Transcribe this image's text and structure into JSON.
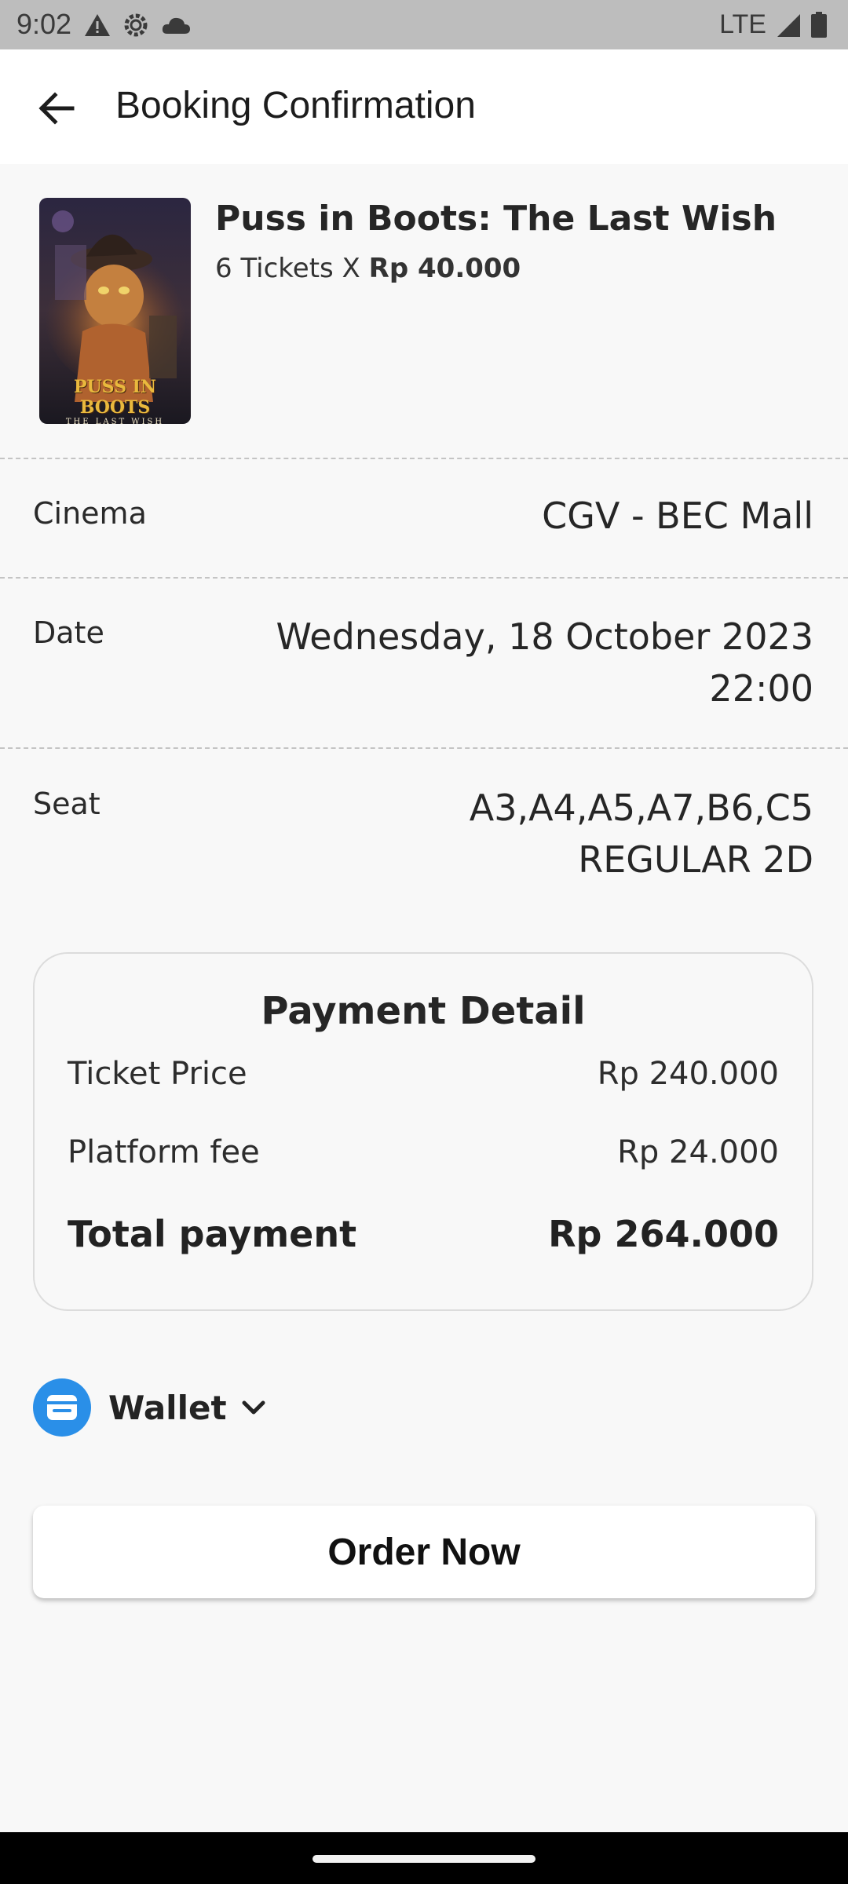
{
  "status_bar": {
    "time": "9:02",
    "network": "LTE",
    "icons_left": [
      "alert-icon",
      "settings-icon",
      "cloud-icon"
    ],
    "icons_right": [
      "signal-icon",
      "battery-icon"
    ]
  },
  "app_bar": {
    "title": "Booking Confirmation",
    "back_icon": "arrow-left-icon"
  },
  "movie": {
    "title": "Puss in Boots: The Last Wish",
    "tickets_text": "6 Tickets X",
    "ticket_price": "Rp 40.000",
    "poster_logo_line1": "PUSS IN BOOTS",
    "poster_logo_line2": "THE LAST WISH"
  },
  "details": {
    "cinema_label": "Cinema",
    "cinema_value": "CGV - BEC Mall",
    "date_label": "Date",
    "date_line1": "Wednesday, 18 October 2023",
    "date_line2": "22:00",
    "seat_label": "Seat",
    "seat_line1": "A3,A4,A5,A7,B6,C5",
    "seat_line2": "REGULAR 2D"
  },
  "payment": {
    "title": "Payment Detail",
    "ticket_price_label": "Ticket Price",
    "ticket_price_value": "Rp 240.000",
    "platform_fee_label": "Platform fee",
    "platform_fee_value": "Rp 24.000",
    "total_label": "Total payment",
    "total_value": "Rp 264.000"
  },
  "wallet": {
    "label": "Wallet",
    "icon": "wallet-icon",
    "color": "#2a8fe8"
  },
  "order_button": {
    "label": "Order Now"
  }
}
